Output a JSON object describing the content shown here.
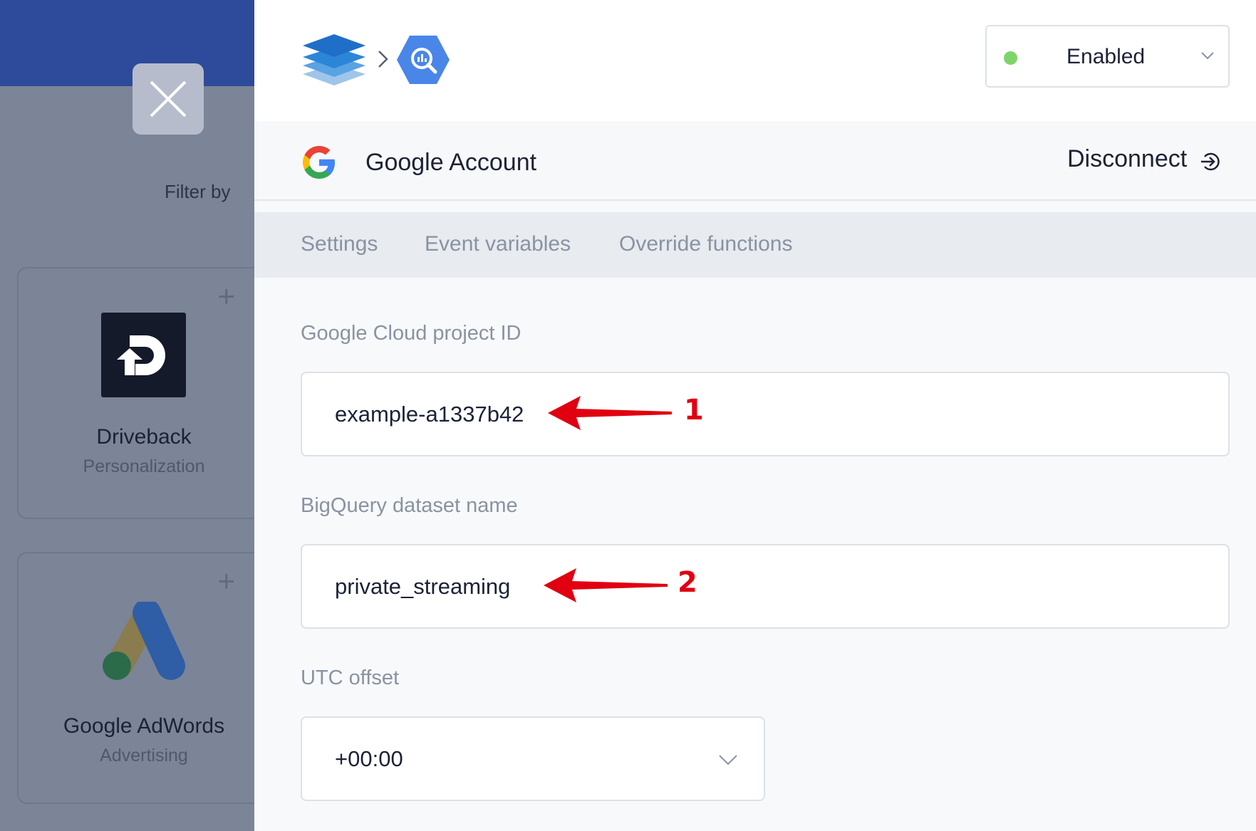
{
  "background": {
    "filter_label": "Filter by",
    "cards": [
      {
        "name": "Driveback",
        "category": "Personalization"
      },
      {
        "name": "Google AdWords",
        "category": "Advertising"
      }
    ]
  },
  "header": {
    "status": {
      "label": "Enabled",
      "color": "#7dd56a"
    }
  },
  "account": {
    "label": "Google Account",
    "disconnect_label": "Disconnect"
  },
  "tabs": [
    {
      "label": "Settings"
    },
    {
      "label": "Event variables"
    },
    {
      "label": "Override functions"
    }
  ],
  "form": {
    "project": {
      "label": "Google Cloud project ID",
      "value": "example-a1337b42"
    },
    "dataset": {
      "label": "BigQuery dataset name",
      "value": "private_streaming"
    },
    "utc": {
      "label": "UTC offset",
      "value": "+00:00"
    }
  },
  "annotations": [
    {
      "number": "1",
      "color": "#e10010"
    },
    {
      "number": "2",
      "color": "#e10010"
    }
  ]
}
